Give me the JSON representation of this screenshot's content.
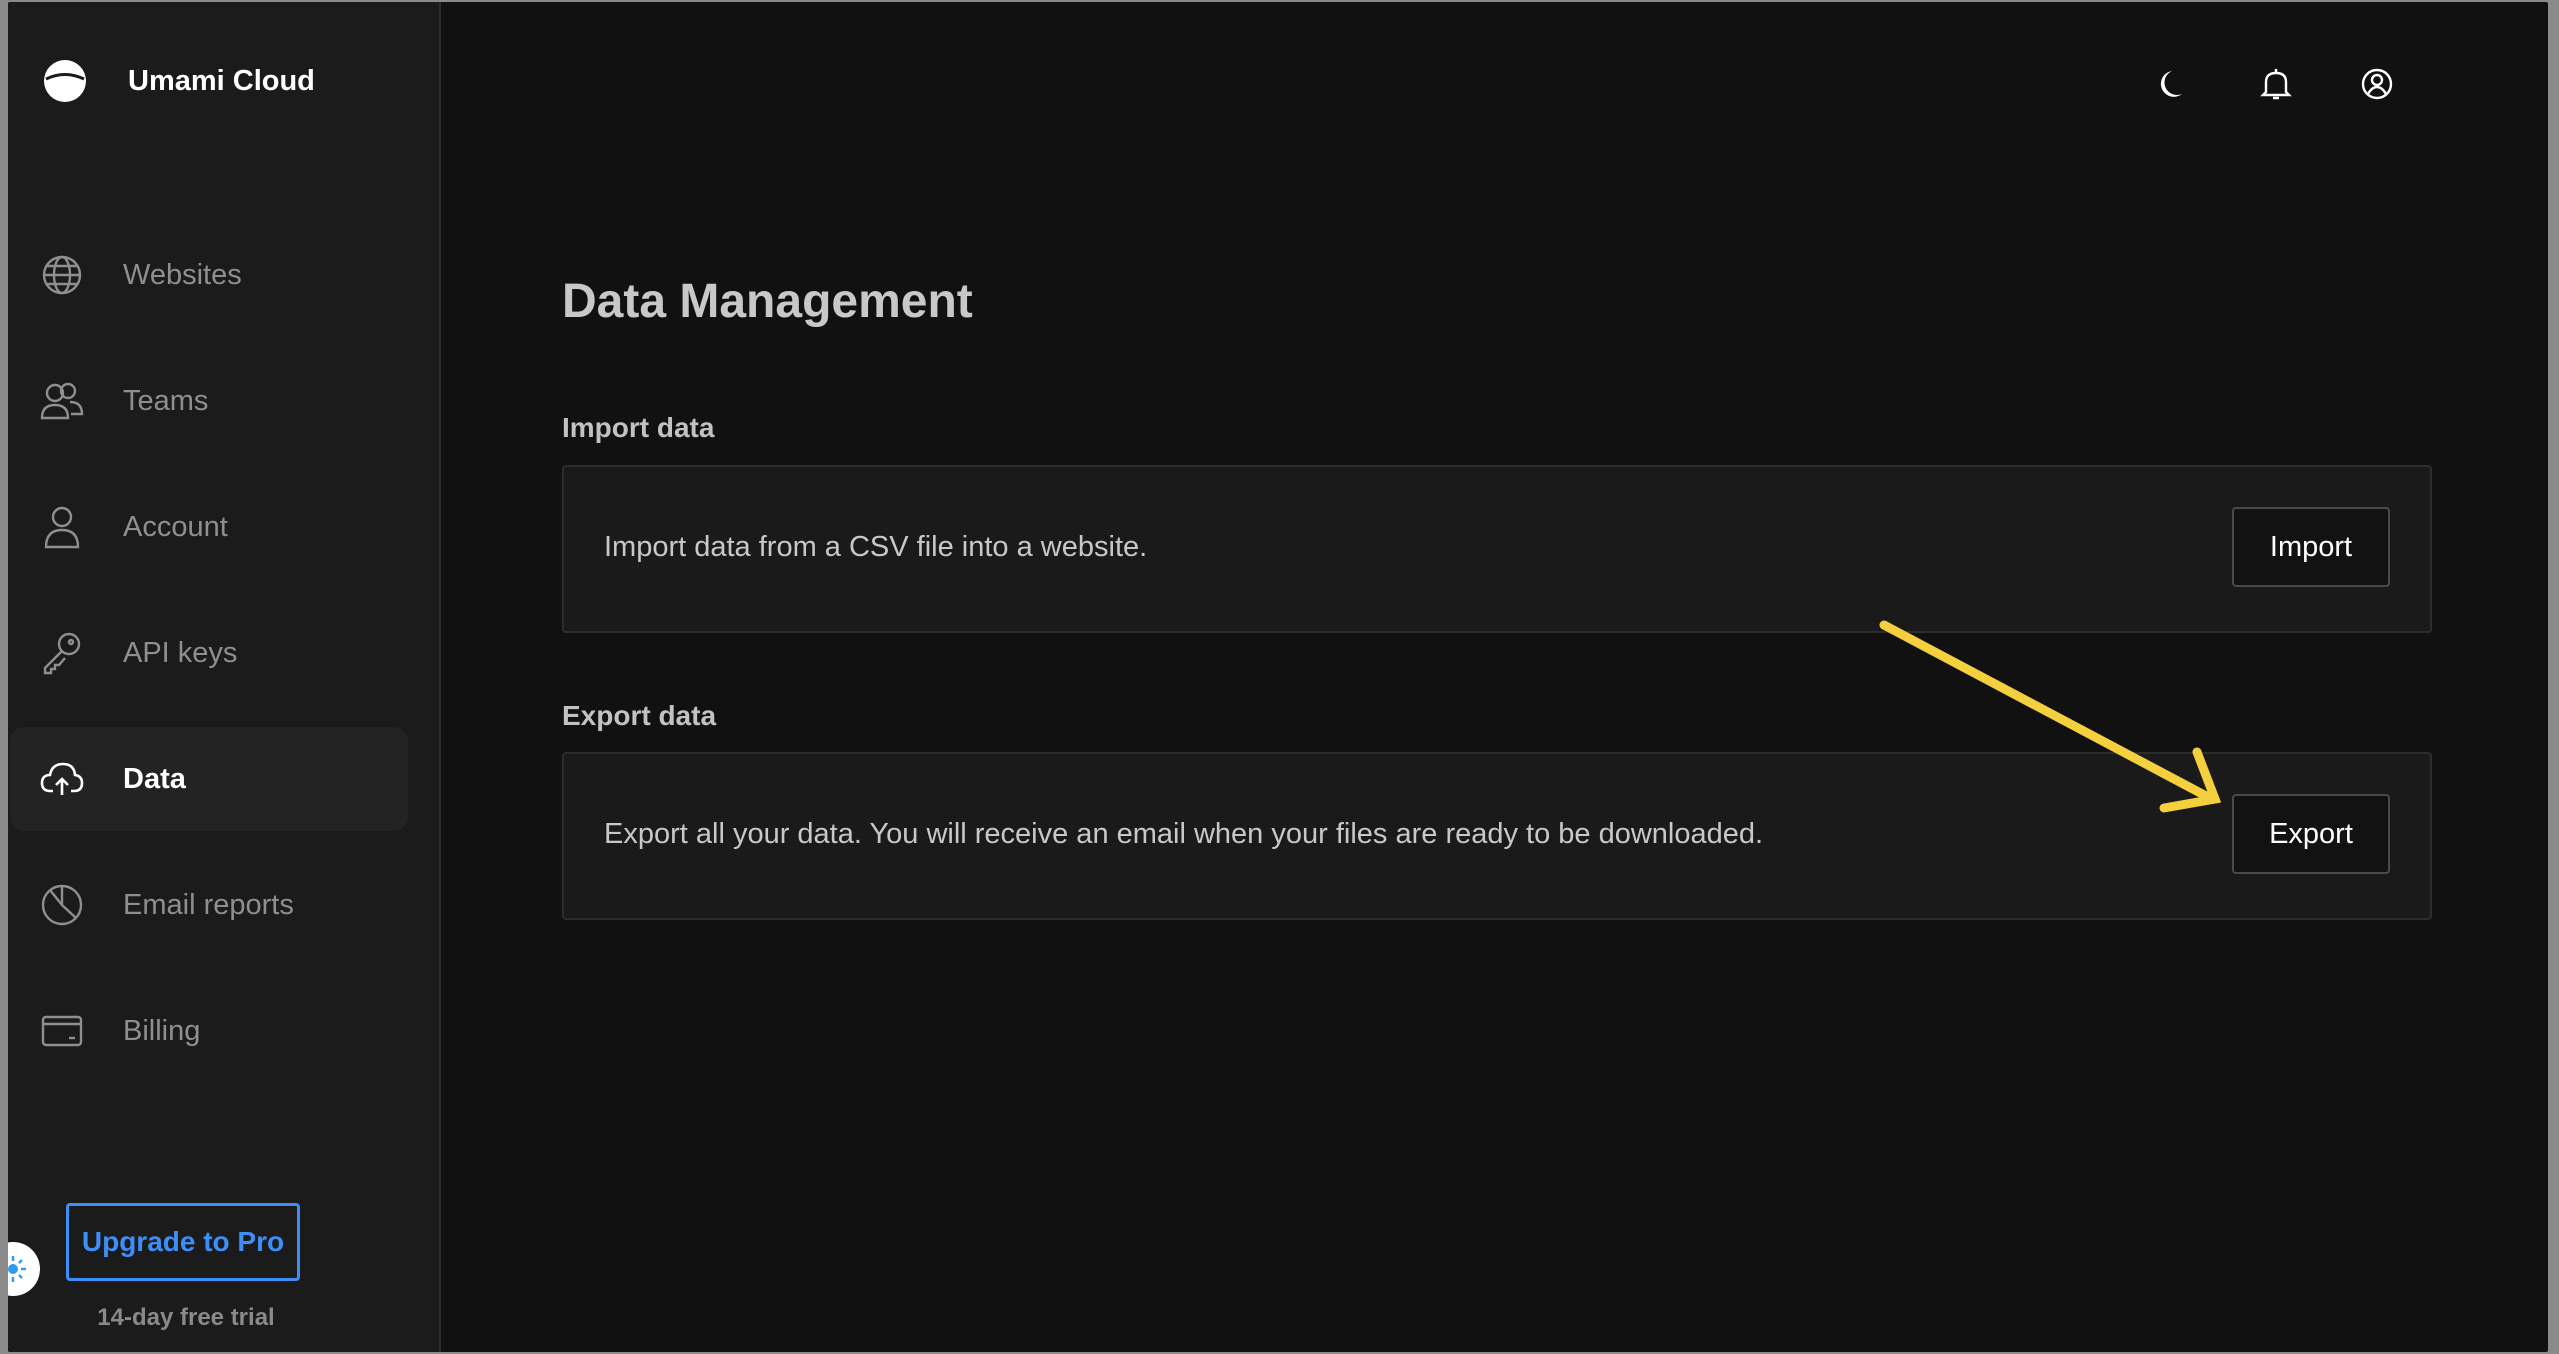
{
  "app": {
    "brand_name": "Umami Cloud",
    "accent_color": "#3e8ef7",
    "annotation_color": "#f4d03f"
  },
  "sidebar": {
    "items": [
      {
        "label": "Websites",
        "icon": "globe-icon",
        "active": false
      },
      {
        "label": "Teams",
        "icon": "users-icon",
        "active": false
      },
      {
        "label": "Account",
        "icon": "user-icon",
        "active": false
      },
      {
        "label": "API keys",
        "icon": "key-icon",
        "active": false
      },
      {
        "label": "Data",
        "icon": "cloud-upload-icon",
        "active": true
      },
      {
        "label": "Email reports",
        "icon": "pie-chart-icon",
        "active": false
      },
      {
        "label": "Billing",
        "icon": "credit-card-icon",
        "active": false
      }
    ],
    "upgrade_label": "Upgrade to Pro",
    "trial_text": "14-day free trial"
  },
  "header": {
    "icons": [
      "moon-icon",
      "bell-icon",
      "profile-icon"
    ]
  },
  "main": {
    "title": "Data Management",
    "import": {
      "section_title": "Import data",
      "description": "Import data from a CSV file into a website.",
      "button_label": "Import"
    },
    "export": {
      "section_title": "Export data",
      "description": "Export all your data. You will receive an email when your files are ready to be downloaded.",
      "button_label": "Export"
    }
  }
}
